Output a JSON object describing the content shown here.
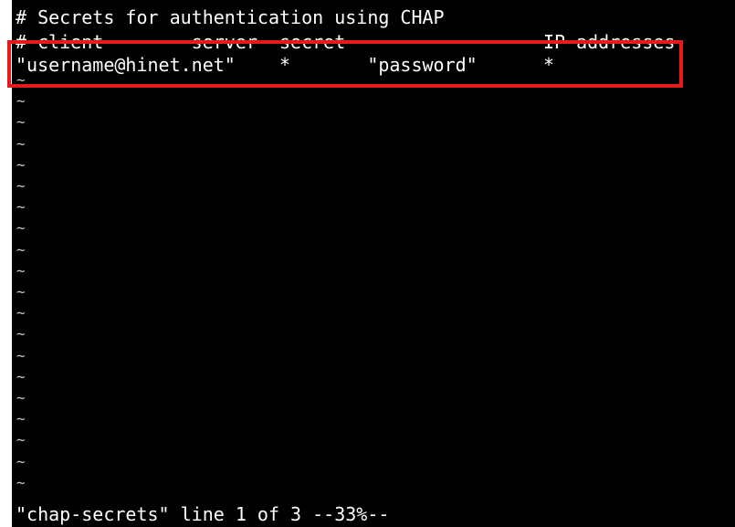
{
  "editor": {
    "lines": [
      "# Secrets for authentication using CHAP",
      "# client        server  secret                  IP addresses",
      "\"username@hinet.net\"    *       \"password\"      *"
    ],
    "empty_line_marker": "~",
    "status_line": "\"chap-secrets\" line 1 of 3 --33%--"
  },
  "colors": {
    "background": "#000000",
    "text": "#ffffff",
    "highlight": "#e51b1b"
  }
}
